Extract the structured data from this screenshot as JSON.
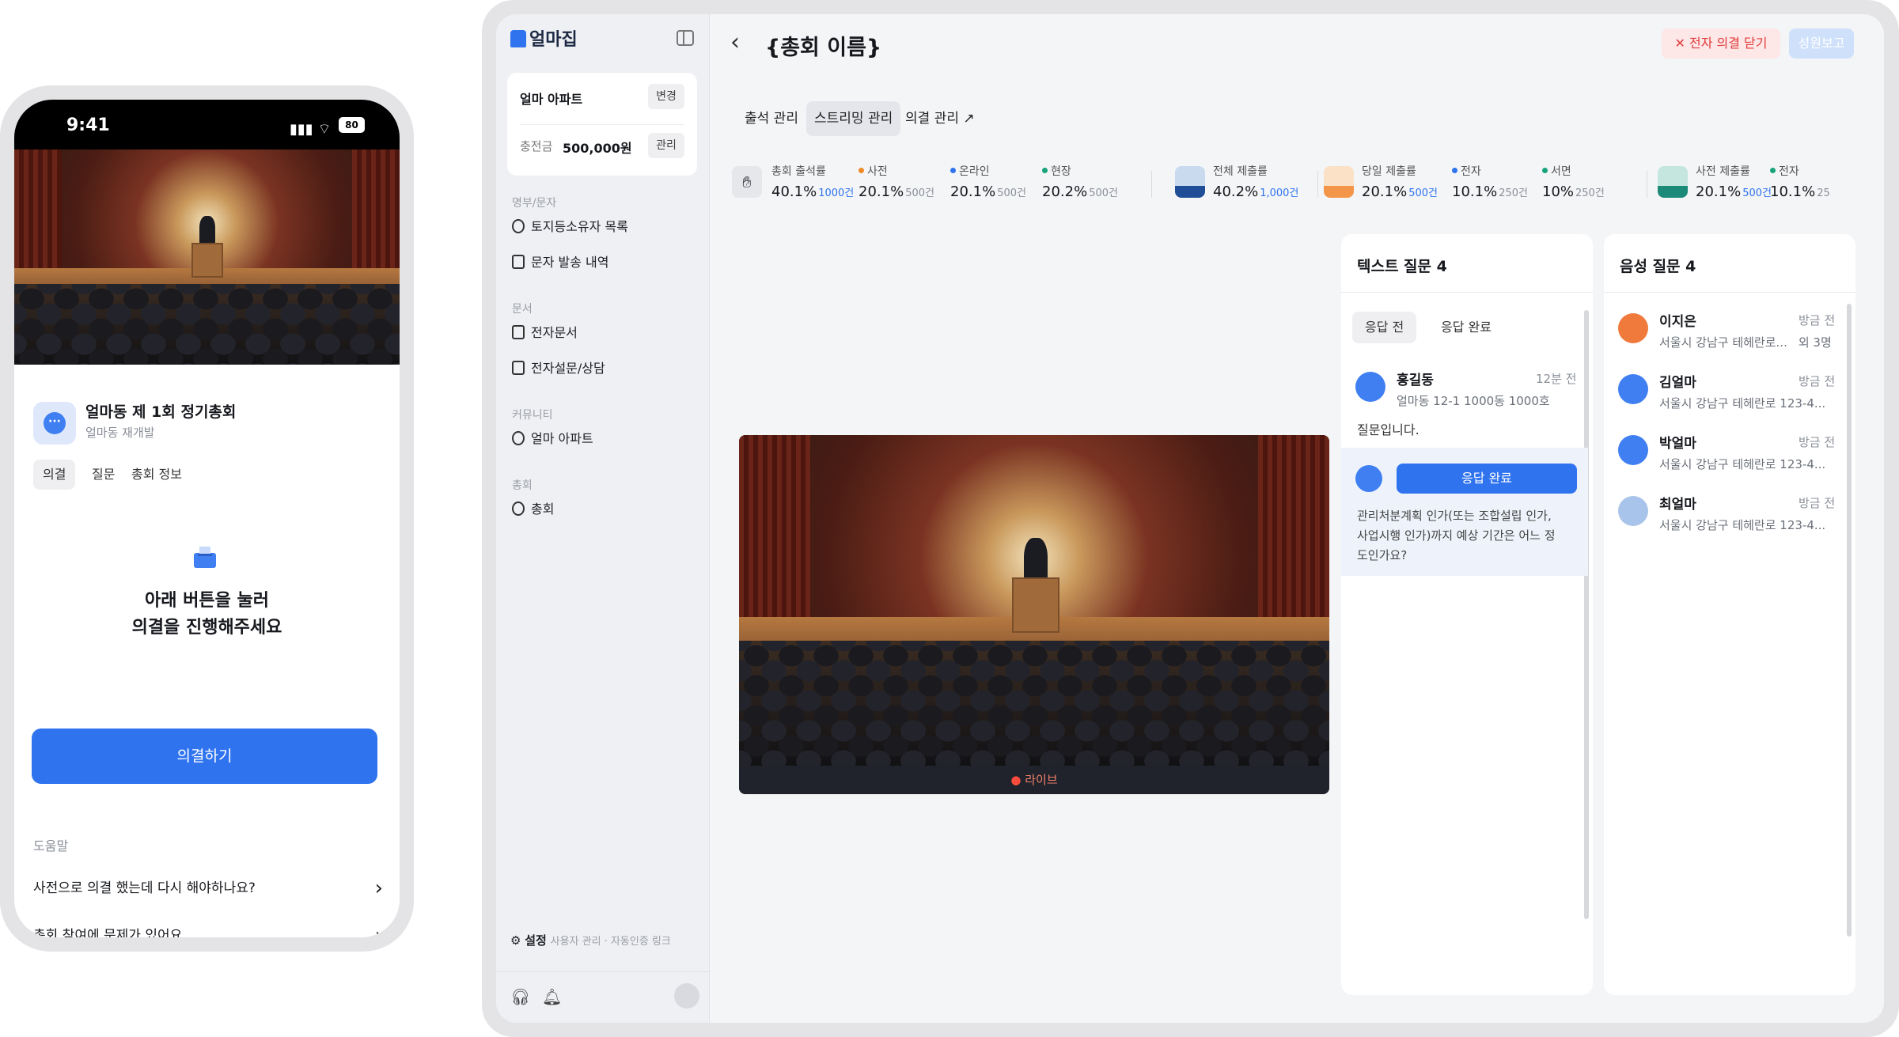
{
  "phone": {
    "status": {
      "time": "9:41",
      "signal": "▮▮▮ ⌔",
      "battery": "80"
    },
    "assembly": {
      "title": "얼마동 제 1회 정기총회",
      "subtitle": "얼마동 재개발"
    },
    "tabs": [
      "의결",
      "질문",
      "총회 정보"
    ],
    "vote_heading_line1": "아래 버튼을 눌러",
    "vote_heading_line2": "의결을 진행해주세요",
    "vote_button": "의결하기",
    "help_label": "도움말",
    "help_items": [
      "사전으로 의결 했는데 다시 해야하나요?",
      "총회 참여에 문제가 있어요"
    ]
  },
  "sidebar": {
    "logo": "얼마집",
    "apt_name": "얼마 아파트",
    "change_label": "변경",
    "charge_label": "충전금",
    "charge_amount": "500,000원",
    "manage_label": "관리",
    "sections": [
      {
        "label": "명부/문자",
        "items": [
          "토지등소유자 목록",
          "문자 발송 내역"
        ]
      },
      {
        "label": "문서",
        "items": [
          "전자문서",
          "전자설문/상담"
        ]
      },
      {
        "label": "커뮤니티",
        "items": [
          "얼마 아파트"
        ]
      },
      {
        "label": "총회",
        "items": [
          "총회"
        ]
      }
    ],
    "settings_label": "설정",
    "settings_sub": "사용자 관리 · 자동인증 링크"
  },
  "header": {
    "title": "{총회 이름}",
    "close_vote": "전자 의결 닫기",
    "report": "성원보고"
  },
  "main_tabs": [
    "출석 관리",
    "스트리밍 관리",
    "의결 관리 ↗"
  ],
  "stats": {
    "attendance": {
      "label": "총회 출석률",
      "value": "40.1%",
      "count": "1000건"
    },
    "pre": {
      "label": "사전",
      "value": "20.1%",
      "count": "500건"
    },
    "online": {
      "label": "온라인",
      "value": "20.1%",
      "count": "500건"
    },
    "onsite": {
      "label": "현장",
      "value": "20.2%",
      "count": "500건"
    },
    "total_submit": {
      "label": "전체 제출률",
      "value": "40.2%",
      "count": "1,000건"
    },
    "sameday": {
      "label": "당일 제출률",
      "value": "20.1%",
      "count": "500건"
    },
    "electronic": {
      "label": "전자",
      "value": "10.1%",
      "count": "250건"
    },
    "written": {
      "label": "서면",
      "value": "10%",
      "count": "250건"
    },
    "pre_submit": {
      "label": "사전 제출률",
      "value": "20.1%",
      "count": "500건"
    },
    "electronic2": {
      "label": "전자",
      "value": "10.1%",
      "count": "25"
    }
  },
  "video": {
    "live_label": "라이브"
  },
  "text_questions": {
    "title": "텍스트 질문 4",
    "subtabs": [
      "응답 전",
      "응답 완료"
    ],
    "items": [
      {
        "name": "홍길동",
        "time": "12분 전",
        "address": "얼마동 12-1 1000동 1000호",
        "body": "질문입니다."
      },
      {
        "answered_label": "응답 완료",
        "body_line1": "관리처분계획 인가(또는 조합설립 인가,",
        "body_line2": "사업시행 인가)까지 예상 기간은 어느 정",
        "body_line3": "도인가요?"
      }
    ]
  },
  "voice_questions": {
    "title": "음성 질문 4",
    "items": [
      {
        "name": "이지은",
        "time": "방금 전",
        "address": "서울시 강남구 테헤란로...",
        "extra": "외 3명"
      },
      {
        "name": "김얼마",
        "time": "방금 전",
        "address": "서울시 강남구 테헤란로 123-4..."
      },
      {
        "name": "박얼마",
        "time": "방금 전",
        "address": "서울시 강남구 테헤란로 123-4..."
      },
      {
        "name": "최얼마",
        "time": "방금 전",
        "address": "서울시 강남구 테헤란로 123-4..."
      }
    ]
  },
  "colors": {
    "accent": "#2f73ef",
    "danger": "#e23b3b",
    "pre_dot": "#f08a2b",
    "online_dot": "#2f73ef",
    "onsite_dot": "#17a37c"
  }
}
